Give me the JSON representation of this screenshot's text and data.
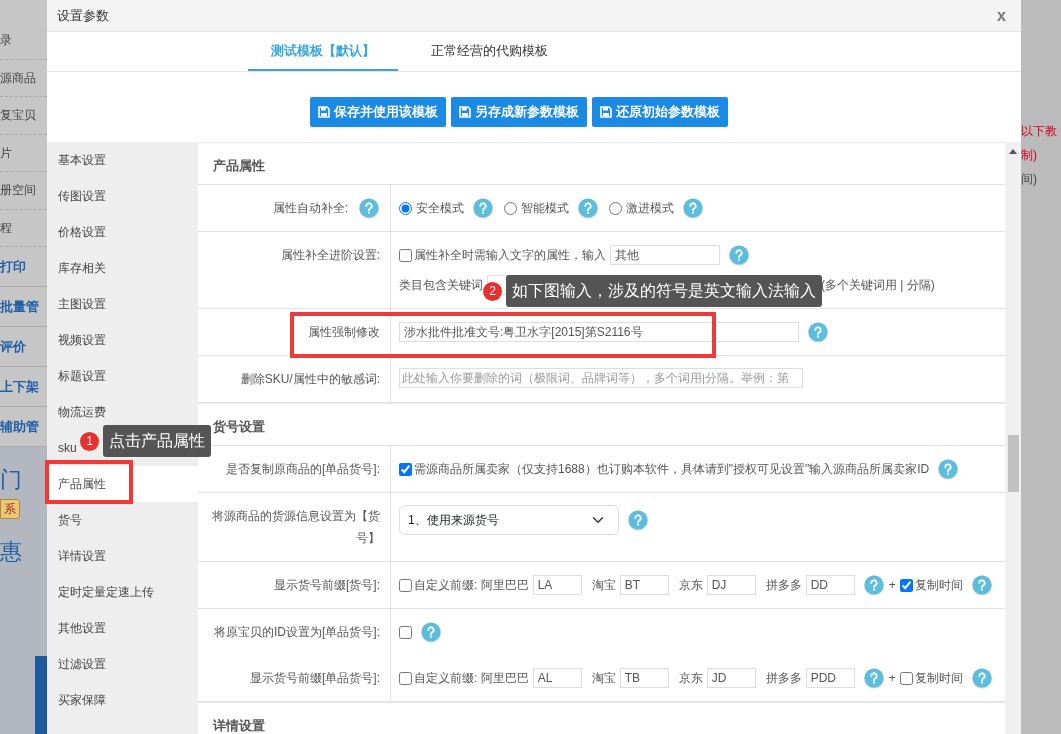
{
  "background_left": [
    {
      "text": "录",
      "kind": "plain"
    },
    {
      "text": "源商品",
      "kind": "plain"
    },
    {
      "text": "复宝贝",
      "kind": "plain"
    },
    {
      "text": "片",
      "kind": "plain"
    },
    {
      "text": "册空间",
      "kind": "plain"
    },
    {
      "text": "程",
      "kind": "plain"
    },
    {
      "text": "打印",
      "kind": "bold"
    },
    {
      "text": "批量管",
      "kind": "bold"
    },
    {
      "text": "评价",
      "kind": "bold"
    },
    {
      "text": "上下架",
      "kind": "bold"
    },
    {
      "text": "辅助管",
      "kind": "bold"
    },
    {
      "text": "门",
      "kind": "large"
    },
    {
      "text": "系",
      "kind": "badge"
    },
    {
      "text": "惠",
      "kind": "large"
    }
  ],
  "background_right": [
    {
      "text": "以下教",
      "kind": "red"
    },
    {
      "text": "制)",
      "kind": "red"
    },
    {
      "text": "间)",
      "kind": "plain"
    }
  ],
  "dialog": {
    "title": "设置参数",
    "close": "x"
  },
  "tabs": [
    {
      "label": "测试模板【默认】",
      "selected": true
    },
    {
      "label": "正常经营的代购模板",
      "selected": false
    }
  ],
  "buttons": [
    "保存并使用该模板",
    "另存成新参数模板",
    "还原初始参数模板"
  ],
  "menu": [
    {
      "label": "基本设置",
      "selected": false
    },
    {
      "label": "传图设置",
      "selected": false
    },
    {
      "label": "价格设置",
      "selected": false
    },
    {
      "label": "库存相关",
      "selected": false
    },
    {
      "label": "主图设置",
      "selected": false
    },
    {
      "label": "视频设置",
      "selected": false
    },
    {
      "label": "标题设置",
      "selected": false
    },
    {
      "label": "物流运费",
      "selected": false
    },
    {
      "label": "sku",
      "selected": false
    },
    {
      "label": "产品属性",
      "selected": true,
      "highlighted": true
    },
    {
      "label": "货号",
      "selected": false
    },
    {
      "label": "详情设置",
      "selected": false
    },
    {
      "label": "定时定量定速上传",
      "selected": false
    },
    {
      "label": "其他设置",
      "selected": false
    },
    {
      "label": "过滤设置",
      "selected": false
    },
    {
      "label": "买家保障",
      "selected": false
    }
  ],
  "sections": [
    {
      "title": "产品属性",
      "rows": [
        {
          "label": "属性自动补全:",
          "label_help": true,
          "controls": [
            {
              "kind": "radio",
              "label": "安全模式",
              "selected": true
            },
            {
              "kind": "help"
            },
            {
              "kind": "radio",
              "label": "智能模式",
              "selected": false
            },
            {
              "kind": "help"
            },
            {
              "kind": "radio",
              "label": "激进模式",
              "selected": false
            },
            {
              "kind": "help"
            }
          ]
        },
        {
          "label": "属性补全进阶设置:",
          "controls": [
            {
              "kind": "checkbox",
              "label": "属性补全时需输入文字的属性，输入",
              "checked": false
            },
            {
              "kind": "input",
              "value": "其他"
            },
            {
              "kind": "help"
            },
            {
              "kind": "break"
            },
            {
              "kind": "text",
              "text": "类目包含关键词"
            },
            {
              "kind": "long-input"
            },
            {
              "kind": "text",
              "text": "(多个关键词用 | 分隔)"
            }
          ]
        },
        {
          "label": "属性强制修改",
          "highlighted": true,
          "controls": [
            {
              "kind": "wide-input",
              "value": "涉水批件批准文号:粤卫水字[2015]第S2116号"
            },
            {
              "kind": "help"
            }
          ]
        },
        {
          "label": "删除SKU/属性中的敏感词:",
          "controls": [
            {
              "kind": "wide-input",
              "placeholder": "此处输入你要删除的词（极限词、品牌词等），多个词用|分隔。举例：第"
            }
          ]
        }
      ]
    },
    {
      "title": "货号设置",
      "rows": [
        {
          "label": "是否复制原商品的[单品货号]:",
          "controls": [
            {
              "kind": "checkbox",
              "label": "需源商品所属卖家（仅支持1688）也订购本软件，具体请到\"授权可见设置\"输入源商品所属卖家ID",
              "checked": true
            },
            {
              "kind": "help"
            }
          ]
        },
        {
          "label": "将源商品的货源信息设置为【货号】",
          "controls": [
            {
              "kind": "select",
              "value": "1、使用来源货号"
            },
            {
              "kind": "help"
            }
          ]
        },
        {
          "label": "显示货号前缀[货号]:",
          "controls": [
            {
              "kind": "checkbox",
              "label": "自定义前缀: 阿里巴巴",
              "checked": false
            },
            {
              "kind": "prefix-input",
              "value": "LA"
            },
            {
              "kind": "text",
              "text": "淘宝"
            },
            {
              "kind": "prefix-input",
              "value": "BT"
            },
            {
              "kind": "text",
              "text": "京东"
            },
            {
              "kind": "prefix-input",
              "value": "DJ"
            },
            {
              "kind": "text",
              "text": "拼多多"
            },
            {
              "kind": "prefix-input",
              "value": "DD"
            },
            {
              "kind": "help"
            },
            {
              "kind": "text",
              "text": "+"
            },
            {
              "kind": "checkbox",
              "label": "复制时间",
              "checked": true
            },
            {
              "kind": "help"
            }
          ]
        },
        {
          "label": "将原宝贝的ID设置为[单品货号]:",
          "divider": false,
          "controls": [
            {
              "kind": "checkbox",
              "checked": false
            },
            {
              "kind": "help"
            }
          ]
        },
        {
          "label": "显示货号前缀[单品货号]:",
          "controls": [
            {
              "kind": "checkbox",
              "label": "自定义前缀: 阿里巴巴",
              "checked": false
            },
            {
              "kind": "prefix-input",
              "value": "AL"
            },
            {
              "kind": "text",
              "text": "淘宝"
            },
            {
              "kind": "prefix-input",
              "value": "TB"
            },
            {
              "kind": "text",
              "text": "京东"
            },
            {
              "kind": "prefix-input",
              "value": "JD"
            },
            {
              "kind": "text",
              "text": "拼多多"
            },
            {
              "kind": "prefix-input",
              "value": "PDD"
            },
            {
              "kind": "help"
            },
            {
              "kind": "text",
              "text": "+"
            },
            {
              "kind": "checkbox",
              "label": "复制时间",
              "checked": false
            },
            {
              "kind": "help"
            }
          ]
        }
      ]
    },
    {
      "title": "详情设置"
    }
  ],
  "annotations": [
    {
      "number": "1",
      "text": "点击产品属性"
    },
    {
      "number": "2",
      "text": "如下图输入，涉及的符号是英文输入法输入"
    }
  ]
}
